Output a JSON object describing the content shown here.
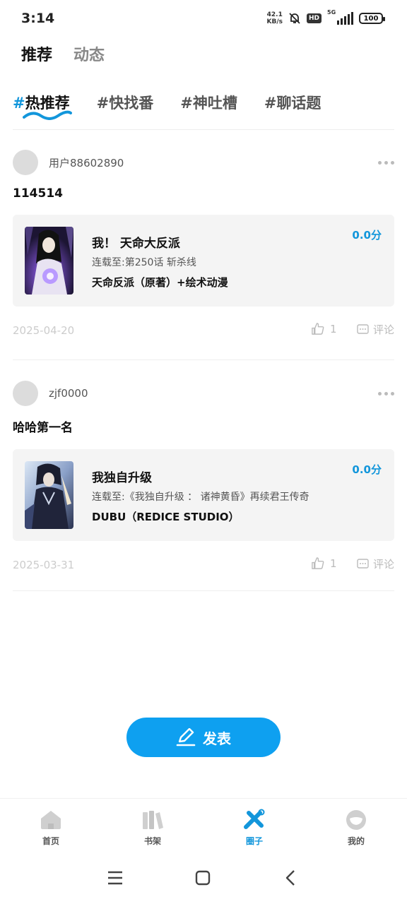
{
  "status_bar": {
    "time": "3:14",
    "net_speed_value": "42.1",
    "net_speed_unit": "KB/s",
    "hd": "HD",
    "network": "5G",
    "battery": "100"
  },
  "top_tabs": [
    {
      "label": "推荐",
      "active": true
    },
    {
      "label": "动态",
      "active": false
    }
  ],
  "tag_tabs": [
    {
      "hash": "#",
      "label": "热推荐",
      "active": true
    },
    {
      "hash": "#",
      "label": "快找番",
      "active": false
    },
    {
      "hash": "#",
      "label": "神吐槽",
      "active": false
    },
    {
      "hash": "#",
      "label": "聊话题",
      "active": false
    }
  ],
  "posts": [
    {
      "username": "用户88602890",
      "text": "114514",
      "comic": {
        "title": "我！ 天命大反派",
        "progress": "连载至:第250话 斩杀线",
        "author": "天命反派（原著）+绘术动漫",
        "score": "0.0分"
      },
      "date": "2025-04-20",
      "likes": "1",
      "comment_label": "评论"
    },
    {
      "username": "zjf0000",
      "text": "哈哈第一名",
      "comic": {
        "title": "我独自升级",
        "progress": "连载至:《我独自升级 ： 诸神黄昏》再续君王传奇",
        "author": "DUBU（REDICE STUDIO）",
        "score": "0.0分"
      },
      "date": "2025-03-31",
      "likes": "1",
      "comment_label": "评论"
    }
  ],
  "publish_button": {
    "label": "发表"
  },
  "bottom_nav": [
    {
      "label": "首页",
      "icon": "home-icon",
      "active": false
    },
    {
      "label": "书架",
      "icon": "bookshelf-icon",
      "active": false
    },
    {
      "label": "圈子",
      "icon": "circle-icon",
      "active": true
    },
    {
      "label": "我的",
      "icon": "profile-icon",
      "active": false
    }
  ],
  "colors": {
    "accent": "#1296db",
    "publish_button": "#0ea0f0",
    "card_bg": "#f4f4f4"
  }
}
